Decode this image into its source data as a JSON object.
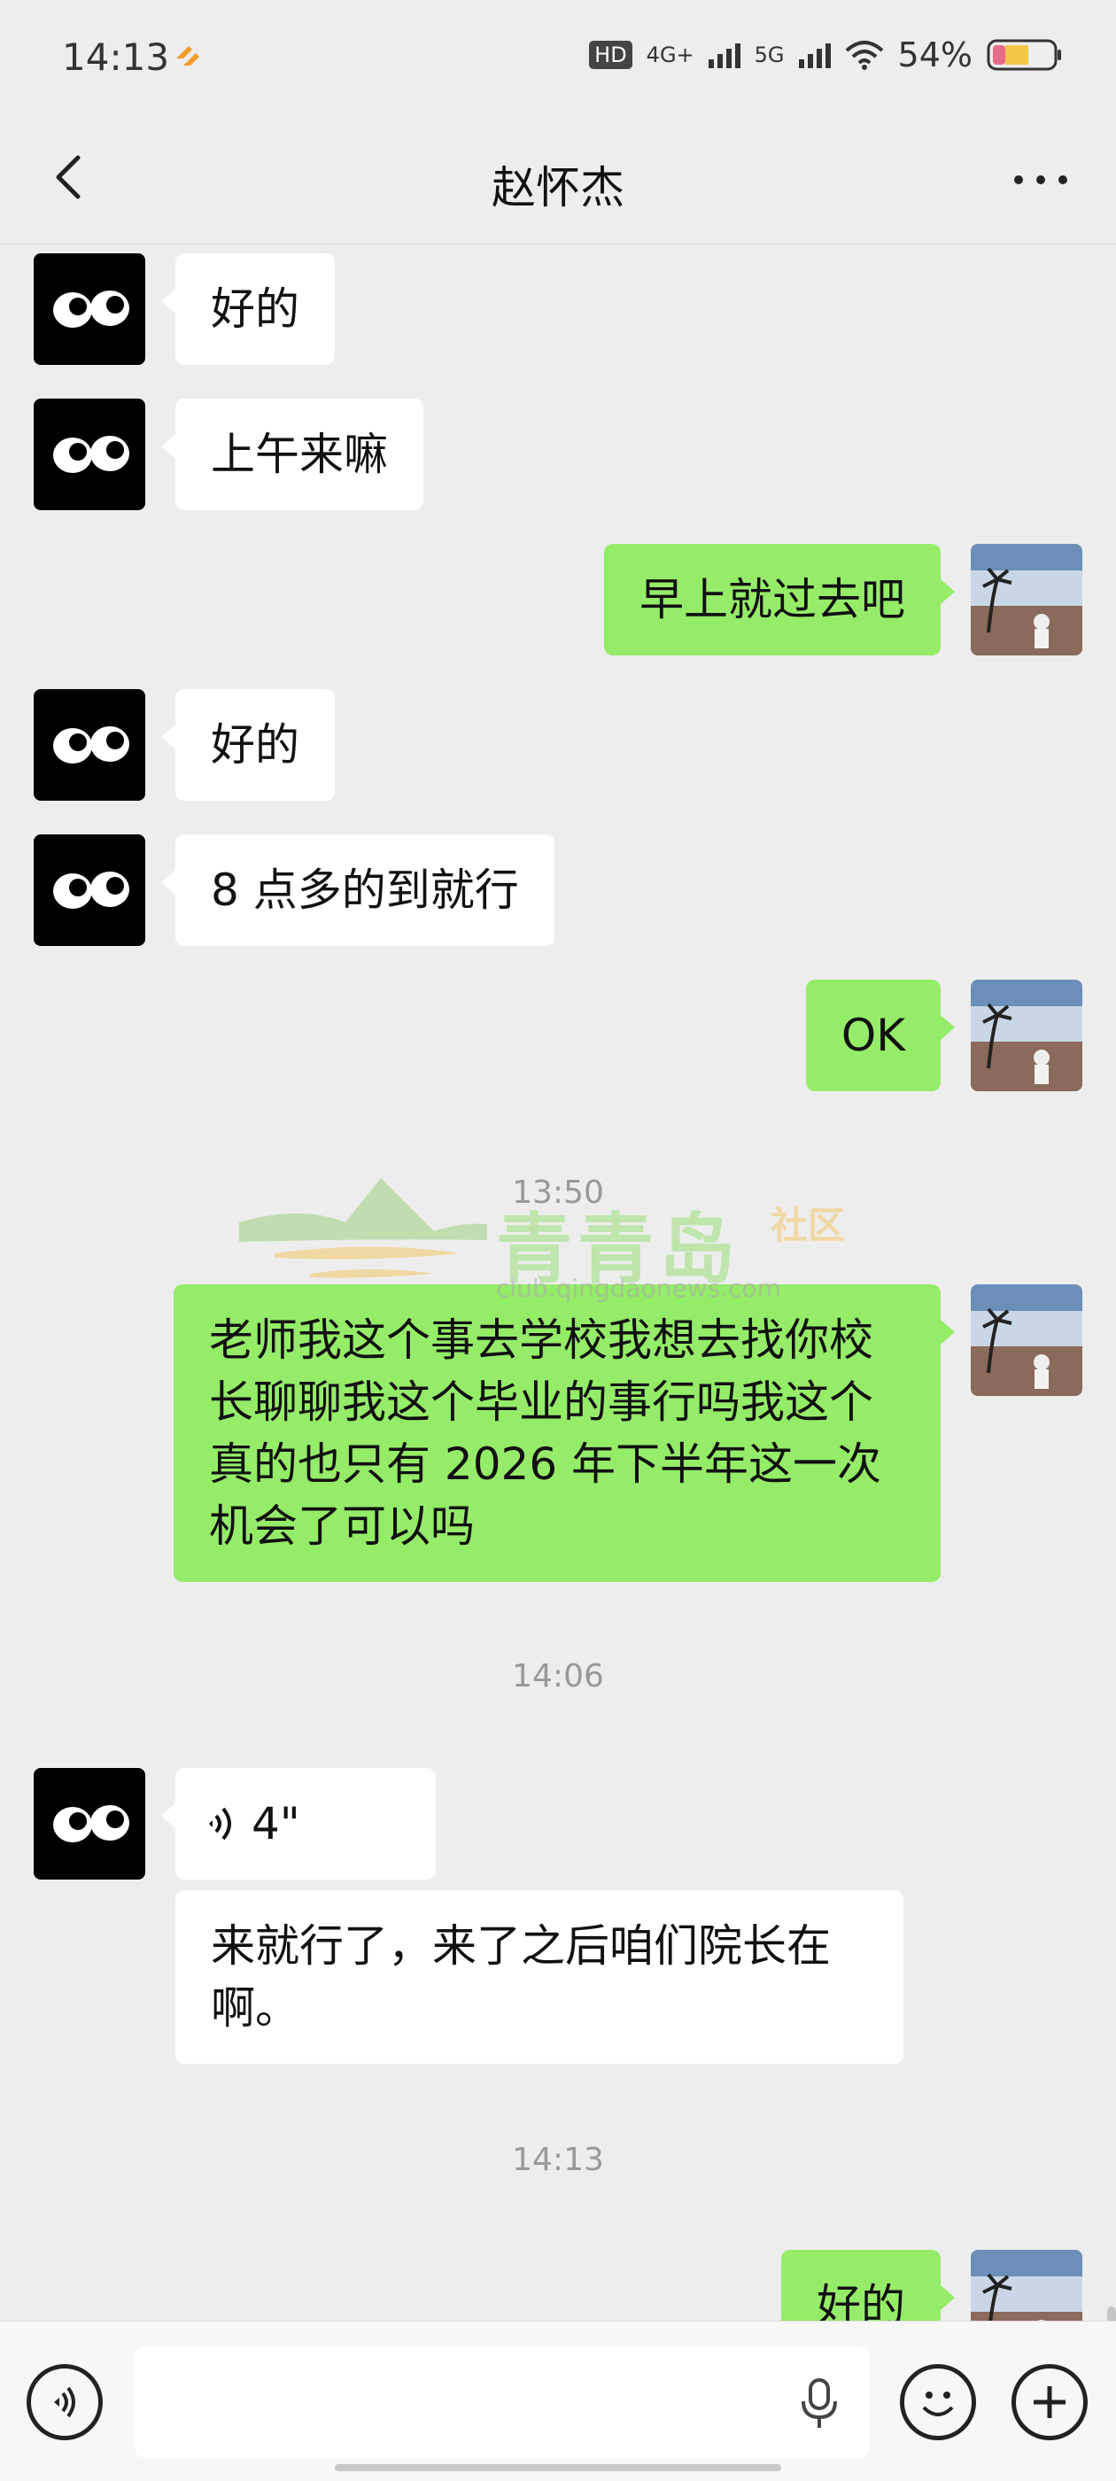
{
  "status_bar": {
    "time": "14:13",
    "network_labels": [
      "HD",
      "4G+",
      "5G"
    ],
    "battery": "54%"
  },
  "header": {
    "title": "赵怀杰",
    "back_icon": "chevron-left-icon",
    "more_icon": "more-dots-icon"
  },
  "messages": [
    {
      "side": "in",
      "text": "好的"
    },
    {
      "side": "in",
      "text": "上午来嘛"
    },
    {
      "side": "out",
      "text": "早上就过去吧"
    },
    {
      "side": "in",
      "text": "好的"
    },
    {
      "side": "in",
      "text": "8 点多的到就行"
    },
    {
      "side": "out",
      "text": "OK"
    },
    {
      "timestamp": "13:50"
    },
    {
      "side": "out",
      "text": "老师我这个事去学校我想去找你校长聊聊我这个毕业的事行吗我这个真的也只有 2026 年下半年这一次机会了可以吗"
    },
    {
      "timestamp": "14:06"
    },
    {
      "side": "in",
      "type": "voice",
      "duration": "4\""
    },
    {
      "side": "in",
      "text": "来就行了，来了之后咱们院长在啊。"
    },
    {
      "timestamp": "14:13"
    },
    {
      "side": "out",
      "text": "好的"
    }
  ],
  "timestamps": [
    "13:50",
    "14:06",
    "14:13"
  ],
  "watermark": {
    "name": "青青岛",
    "suffix": "社区",
    "url": "club.qingdaonews.com"
  },
  "input_bar": {
    "placeholder": "",
    "icons": [
      "voice-toggle-icon",
      "microphone-icon",
      "emoji-icon",
      "plus-icon"
    ]
  },
  "colors": {
    "background": "#ededed",
    "outgoing_bubble": "#95ec69",
    "incoming_bubble": "#ffffff"
  }
}
